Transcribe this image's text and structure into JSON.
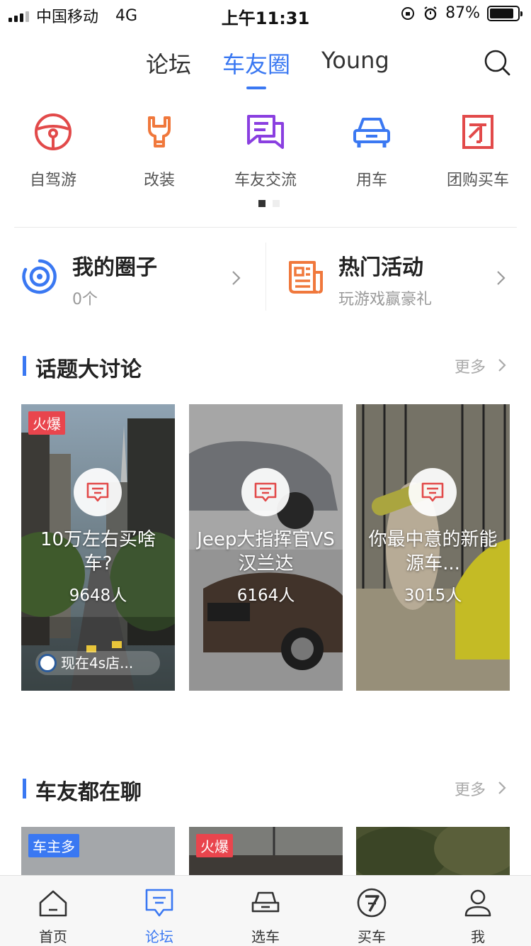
{
  "status_bar": {
    "carrier": "中国移动",
    "network": "4G",
    "time": "上午11:31",
    "battery": "87%",
    "battery_level": 0.87
  },
  "top_tabs": [
    {
      "label": "论坛",
      "active": false
    },
    {
      "label": "车友圈",
      "active": true
    },
    {
      "label": "Young",
      "active": false
    }
  ],
  "categories": [
    {
      "label": "自驾游",
      "icon": "steering-wheel-icon",
      "color": "#e24a4a"
    },
    {
      "label": "改装",
      "icon": "wrench-icon",
      "color": "#f0783c"
    },
    {
      "label": "车友交流",
      "icon": "chat-icon",
      "color": "#8a3fe0"
    },
    {
      "label": "用车",
      "icon": "car-icon",
      "color": "#3a78f2"
    },
    {
      "label": "团购买车",
      "icon": "group-buy-icon",
      "color": "#e24a4a"
    }
  ],
  "quick_cards": {
    "my_circle": {
      "title": "我的圈子",
      "subtitle": "0个"
    },
    "hot_events": {
      "title": "热门活动",
      "subtitle": "玩游戏赢豪礼"
    }
  },
  "topics_section": {
    "title": "话题大讨论",
    "more": "更多",
    "items": [
      {
        "badge": "火爆",
        "title": "10万左右买啥车?",
        "count": "9648人",
        "pill": "现在4s店..."
      },
      {
        "badge": "",
        "title": "Jeep大指挥官VS汉兰达",
        "count": "6164人",
        "pill": ""
      },
      {
        "badge": "",
        "title": "你最中意的新能源车...",
        "count": "3015人",
        "pill": ""
      }
    ]
  },
  "chat_section": {
    "title": "车友都在聊",
    "more": "更多",
    "items": [
      {
        "badge": "车主多",
        "badge_color": "#3a78f2"
      },
      {
        "badge": "火爆",
        "badge_color": "#e9454d"
      },
      {
        "badge": "",
        "badge_color": ""
      }
    ]
  },
  "bottom_tabs": [
    {
      "label": "首页",
      "icon": "home-icon",
      "active": false
    },
    {
      "label": "论坛",
      "icon": "forum-icon",
      "active": true
    },
    {
      "label": "选车",
      "icon": "car-select-icon",
      "active": false
    },
    {
      "label": "买车",
      "icon": "buy-car-icon",
      "active": false
    },
    {
      "label": "我",
      "icon": "profile-icon",
      "active": false
    }
  ],
  "colors": {
    "accent": "#3a78f2",
    "hot_badge": "#e9454d"
  }
}
